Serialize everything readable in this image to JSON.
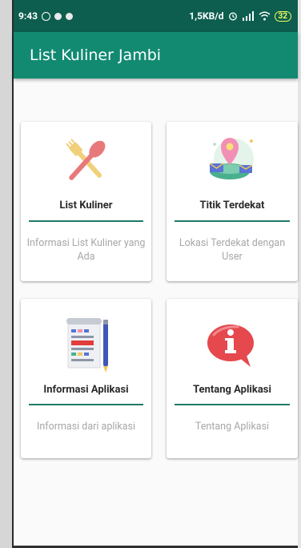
{
  "status_bar": {
    "time": "9:43",
    "network_speed": "1,5KB/d",
    "battery": "32"
  },
  "app_bar": {
    "title": "List Kuliner Jambi"
  },
  "menu": [
    {
      "title": "List Kuliner",
      "description": "Informasi List Kuliner yang Ada",
      "icon": "spoon-fork-icon"
    },
    {
      "title": "Titik Terdekat",
      "description": "Lokasi Terdekat dengan User",
      "icon": "location-map-icon"
    },
    {
      "title": "Informasi Aplikasi",
      "description": "Informasi dari aplikasi",
      "icon": "document-info-icon"
    },
    {
      "title": "Tentang Aplikasi",
      "description": "Tentang Aplikasi",
      "icon": "info-bubble-icon"
    }
  ],
  "colors": {
    "status_bar": "#0d5e4f",
    "app_bar": "#128a72",
    "divider": "#1e7a68"
  }
}
